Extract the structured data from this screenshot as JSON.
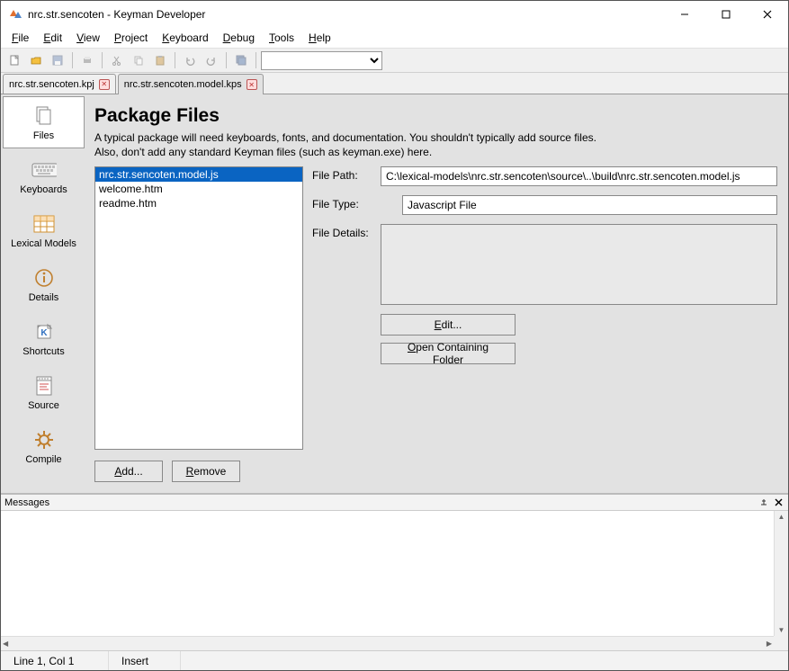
{
  "window": {
    "title": "nrc.str.sencoten - Keyman Developer"
  },
  "menu": {
    "file": "File",
    "edit": "Edit",
    "view": "View",
    "project": "Project",
    "keyboard": "Keyboard",
    "debug": "Debug",
    "tools": "Tools",
    "help": "Help"
  },
  "tabs": [
    {
      "label": "nrc.str.sencoten.kpj",
      "active": false
    },
    {
      "label": "nrc.str.sencoten.model.kps",
      "active": true
    }
  ],
  "sidenav": {
    "files": "Files",
    "keyboards": "Keyboards",
    "lexical": "Lexical Models",
    "details": "Details",
    "shortcuts": "Shortcuts",
    "source": "Source",
    "compile": "Compile"
  },
  "page": {
    "heading": "Package Files",
    "desc1": "A typical package will need keyboards, fonts, and documentation. You shouldn't typically add source files.",
    "desc2": "Also, don't add any standard Keyman files (such as keyman.exe) here."
  },
  "filelist": [
    "nrc.str.sencoten.model.js",
    "welcome.htm",
    "readme.htm"
  ],
  "filelist_selected": 0,
  "labels": {
    "file_path": "File Path:",
    "file_type": "File Type:",
    "file_details": "File Details:"
  },
  "values": {
    "file_path": "C:\\lexical-models\\nrc.str.sencoten\\source\\..\\build\\nrc.str.sencoten.model.js",
    "file_type": "Javascript File"
  },
  "buttons": {
    "add": "Add...",
    "remove": "Remove",
    "edit": "Edit...",
    "open_folder": "Open Containing Folder"
  },
  "messages_panel": {
    "title": "Messages"
  },
  "status": {
    "pos": "Line 1, Col 1",
    "mode": "Insert"
  }
}
